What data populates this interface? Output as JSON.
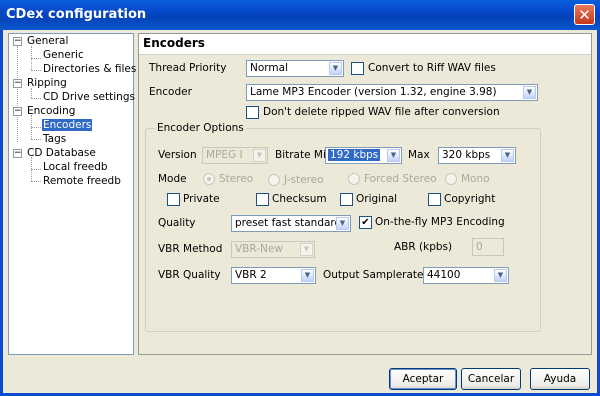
{
  "window": {
    "title": "CDex configuration"
  },
  "tree": {
    "items": [
      {
        "label": "General",
        "level": 0,
        "expander": "−"
      },
      {
        "label": "Generic",
        "level": 1
      },
      {
        "label": "Directories & files",
        "level": 1
      },
      {
        "label": "Ripping",
        "level": 0,
        "expander": "−"
      },
      {
        "label": "CD Drive settings",
        "level": 1
      },
      {
        "label": "Encoding",
        "level": 0,
        "expander": "−"
      },
      {
        "label": "Encoders",
        "level": 1,
        "selected": true
      },
      {
        "label": "Tags",
        "level": 1
      },
      {
        "label": "CD Database",
        "level": 0,
        "expander": "−"
      },
      {
        "label": "Local freedb",
        "level": 1
      },
      {
        "label": "Remote freedb",
        "level": 1
      }
    ]
  },
  "panel": {
    "title": "Encoders",
    "thread_priority_label": "Thread Priority",
    "thread_priority_value": "Normal",
    "convert_riff_label": "Convert to Riff WAV files",
    "encoder_label": "Encoder",
    "encoder_value": "Lame MP3 Encoder (version 1.32, engine 3.98)",
    "dont_delete_label": "Don't delete ripped WAV file after conversion",
    "options": {
      "legend": "Encoder Options",
      "version_label": "Version",
      "version_value": "MPEG I",
      "bitrate_min_label": "Bitrate Min",
      "bitrate_min_value": "192 kbps",
      "max_label": "Max",
      "max_value": "320 kbps",
      "mode_label": "Mode",
      "mode_stereo": "Stereo",
      "mode_jstereo": "J-stereo",
      "mode_forced": "Forced Stereo",
      "mode_mono": "Mono",
      "private_label": "Private",
      "checksum_label": "Checksum",
      "original_label": "Original",
      "copyright_label": "Copyright",
      "quality_label": "Quality",
      "quality_value": "preset fast standard",
      "onthefly_label": "On-the-fly MP3 Encoding",
      "vbr_method_label": "VBR Method",
      "vbr_method_value": "VBR-New",
      "abr_label": "ABR (kpbs)",
      "abr_value": "0",
      "vbr_quality_label": "VBR Quality",
      "vbr_quality_value": "VBR 2",
      "output_samplerate_label": "Output Samplerate",
      "output_samplerate_value": "44100"
    }
  },
  "buttons": {
    "accept": "Aceptar",
    "cancel": "Cancelar",
    "help": "Ayuda"
  },
  "icons": {
    "close": "close-icon",
    "dropdown": "chevron-down-icon",
    "check": "check-icon"
  },
  "colors": {
    "titlebar": "#0a5fd9",
    "selection": "#316ac5",
    "dialog_bg": "#ece9d8"
  }
}
